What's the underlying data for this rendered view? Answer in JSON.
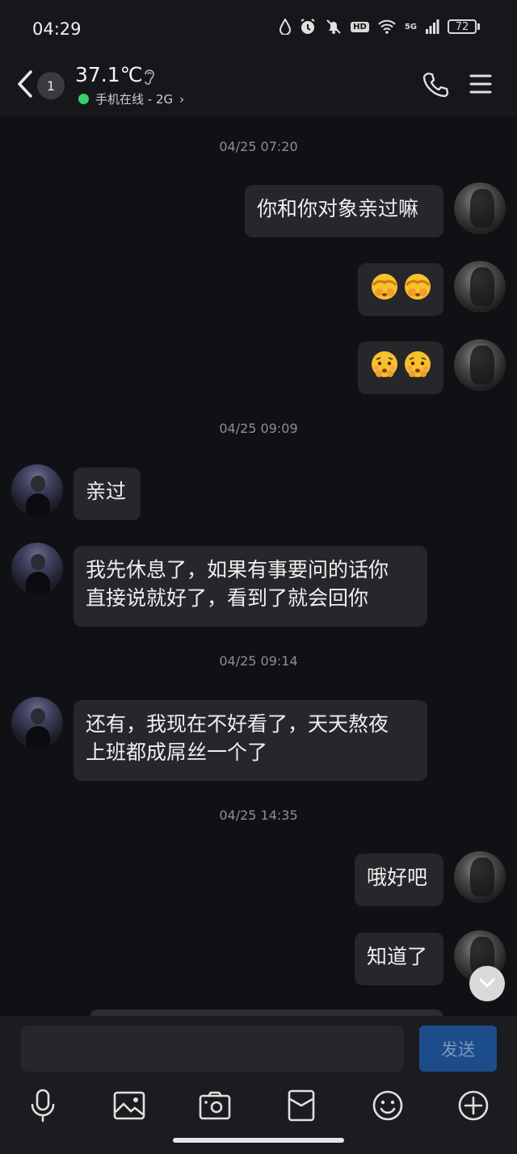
{
  "status_bar": {
    "time": "04:29",
    "network": "5G",
    "hd": "HD",
    "battery": "72"
  },
  "header": {
    "back_icon": "chevron-left-icon",
    "unread_count": "1",
    "title": "37.1℃",
    "presence": "手机在线 - 2G",
    "presence_arrow": "›",
    "presence_color": "#33d26a"
  },
  "messages": [
    {
      "type": "timestamp",
      "text": "04/25 07:20"
    },
    {
      "type": "text",
      "side": "right",
      "text": "你和你对象亲过嘛"
    },
    {
      "type": "emoji",
      "side": "right",
      "emojis": [
        "face-covering-eyes-emoji",
        "face-covering-eyes-emoji"
      ]
    },
    {
      "type": "emoji",
      "side": "right",
      "emojis": [
        "kissing-face-emoji",
        "kissing-face-emoji"
      ]
    },
    {
      "type": "timestamp",
      "text": "04/25 09:09"
    },
    {
      "type": "text",
      "side": "left",
      "text": "亲过"
    },
    {
      "type": "text",
      "side": "left",
      "lines": [
        "我先休息了，如果有事要问的话你",
        "直接说就好了，看到了就会回你"
      ]
    },
    {
      "type": "timestamp",
      "text": "04/25 09:14"
    },
    {
      "type": "text",
      "side": "left",
      "lines": [
        "还有，我现在不好看了，天天熬夜",
        "上班都成屌丝一个了"
      ]
    },
    {
      "type": "timestamp",
      "text": "04/25 14:35"
    },
    {
      "type": "text",
      "side": "right",
      "text": "哦好吧"
    },
    {
      "type": "text",
      "side": "right",
      "text": "知道了"
    }
  ],
  "composer": {
    "input_value": "",
    "send_label": "发送",
    "send_color": "#1c4d8a"
  },
  "toolbar": [
    "microphone-icon",
    "image-icon",
    "camera-icon",
    "red-packet-icon",
    "smiley-icon",
    "plus-icon"
  ]
}
